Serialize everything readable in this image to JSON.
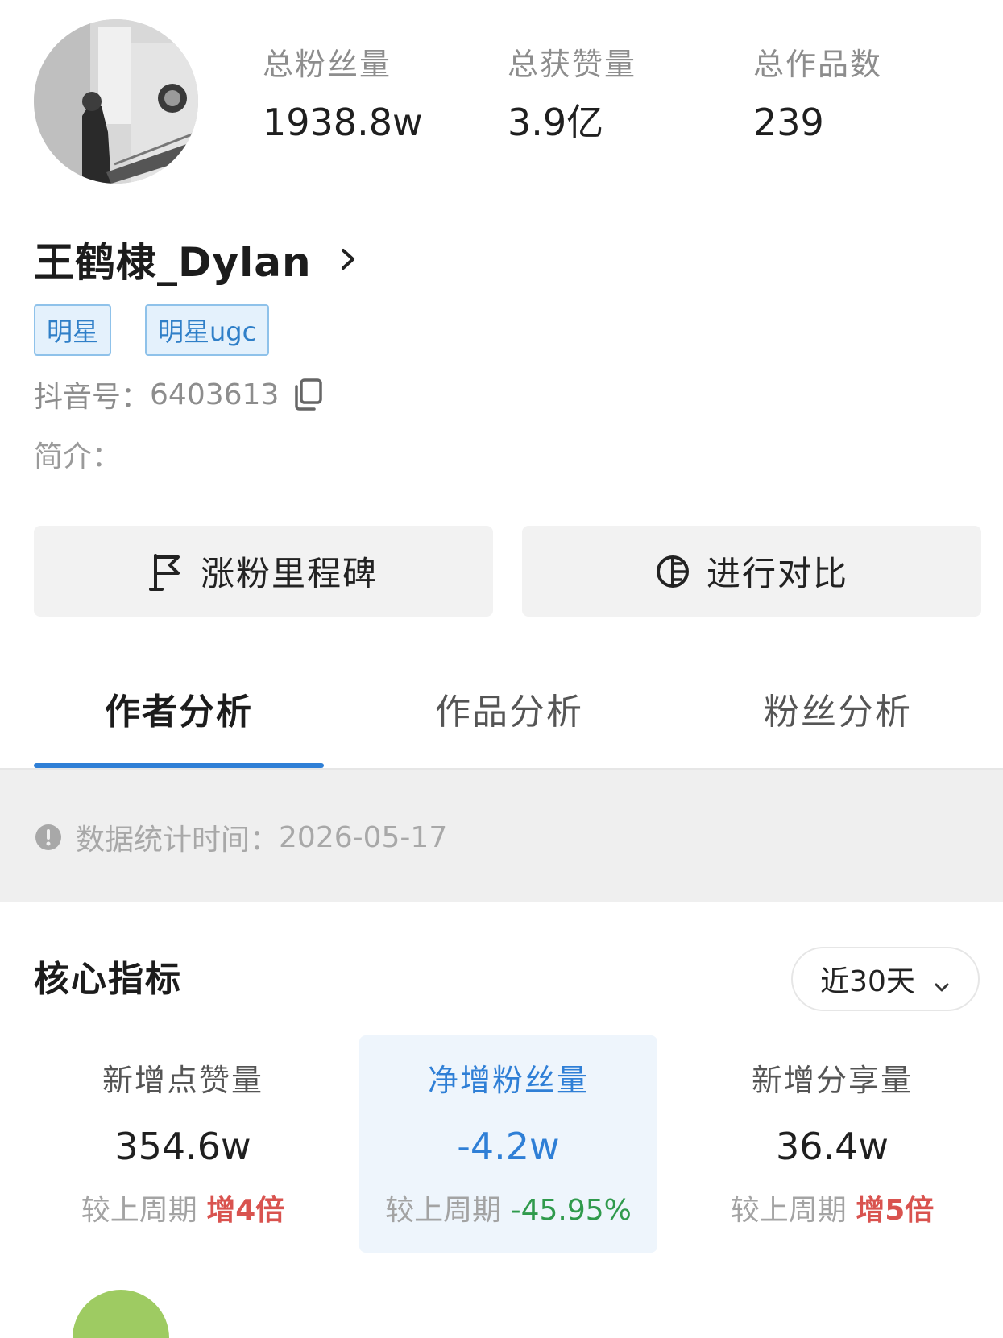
{
  "profile": {
    "name": "王鹤棣_Dylan",
    "tags": [
      "明星",
      "明星ugc"
    ],
    "douyin_label": "抖音号：",
    "douyin_id": "6403613",
    "bio_label": "简介："
  },
  "stats": [
    {
      "label": "总粉丝量",
      "value": "1938.8w"
    },
    {
      "label": "总获赞量",
      "value": "3.9亿"
    },
    {
      "label": "总作品数",
      "value": "239"
    }
  ],
  "actions": {
    "milestone_label": "涨粉里程碑",
    "compare_label": "进行对比"
  },
  "tabs": [
    {
      "label": "作者分析",
      "active": true
    },
    {
      "label": "作品分析",
      "active": false
    },
    {
      "label": "粉丝分析",
      "active": false
    }
  ],
  "date_info": {
    "label": "数据统计时间：",
    "date": "2026-05-17"
  },
  "core": {
    "title": "核心指标",
    "range": "近30天",
    "compare_prefix": "较上周期",
    "metrics": [
      {
        "label": "新增点赞量",
        "value": "354.6w",
        "delta": "增4倍",
        "direction": "up"
      },
      {
        "label": "净增粉丝量",
        "value": "-4.2w",
        "delta": "-45.95%",
        "direction": "down"
      },
      {
        "label": "新增分享量",
        "value": "36.4w",
        "delta": "增5倍",
        "direction": "up"
      }
    ]
  },
  "colors": {
    "accent": "#2f7fd6",
    "up": "#d9534f",
    "down": "#2f9a4c",
    "tag_bg": "#e4f1fc",
    "tag_border": "#8fc2ea"
  },
  "icons": [
    "avatar-photo",
    "chevron-right-icon",
    "copy-icon",
    "flag-icon",
    "compare-icon",
    "info-icon",
    "chevron-down-icon"
  ]
}
